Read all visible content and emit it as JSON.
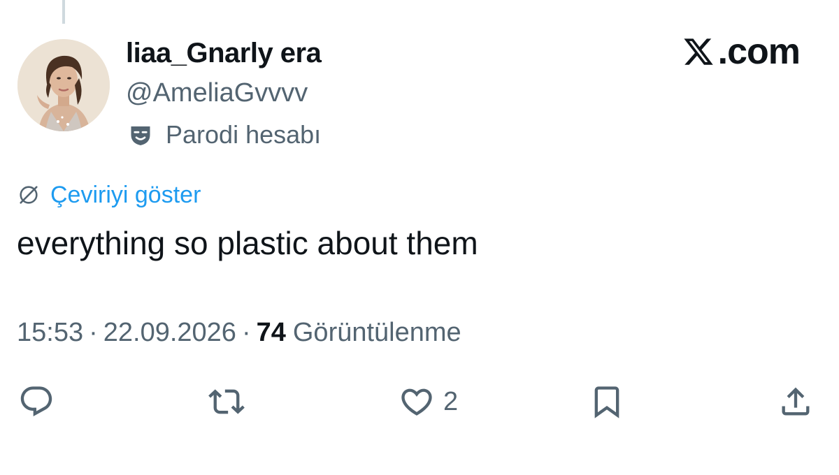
{
  "author": {
    "display_name": "liaa_Gnarly era",
    "handle": "@AmeliaGvvvv",
    "badge_label": "Parodi hesabı",
    "badge_icon": "parody-mask-icon",
    "avatar": "profile-photo"
  },
  "brand": {
    "logo_icon": "x-logo-icon",
    "text": ".com"
  },
  "translate": {
    "icon": "globe-icon",
    "label": "Çeviriyi göster"
  },
  "tweet": {
    "text": "everything so plastic about them"
  },
  "meta": {
    "time": "15:53",
    "separator": "·",
    "date": "22.09.2026",
    "views_count": "74",
    "views_label": "Görüntülenme"
  },
  "actions": {
    "reply_icon": "reply-icon",
    "retweet_icon": "retweet-icon",
    "like_icon": "heart-icon",
    "like_count": "2",
    "bookmark_icon": "bookmark-icon",
    "share_icon": "share-icon"
  },
  "colors": {
    "text_primary": "#0f1419",
    "text_secondary": "#536471",
    "link_blue": "#1d9bf0",
    "thread_line": "#cfd9de",
    "background": "#ffffff"
  }
}
